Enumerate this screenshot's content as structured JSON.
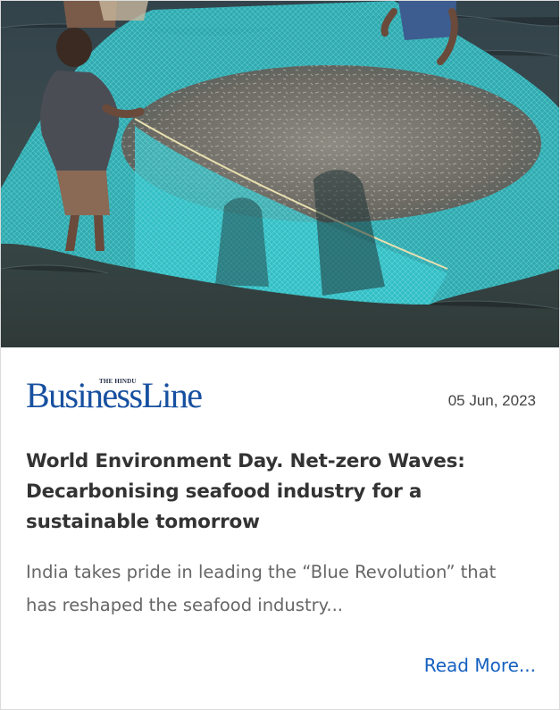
{
  "image": {
    "alt": "Fishermen hauling a turquoise net filled with small silver fish in shallow water"
  },
  "source": {
    "kicker": "THE HINDU",
    "name": "BusinessLine",
    "brand_color": "#1750a0"
  },
  "date": "05 Jun, 2023",
  "title": "World Environment Day. Net-zero Waves: Decarbonising seafood industry for a sustainable tomorrow",
  "excerpt": "India takes pride in leading the “Blue Revolution” that has reshaped the seafood industry...",
  "read_more_label": "Read More...",
  "colors": {
    "link": "#1560c0",
    "title": "#333333",
    "excerpt": "#666666",
    "net": "#2ec4c8",
    "water": "#2f3f44"
  }
}
